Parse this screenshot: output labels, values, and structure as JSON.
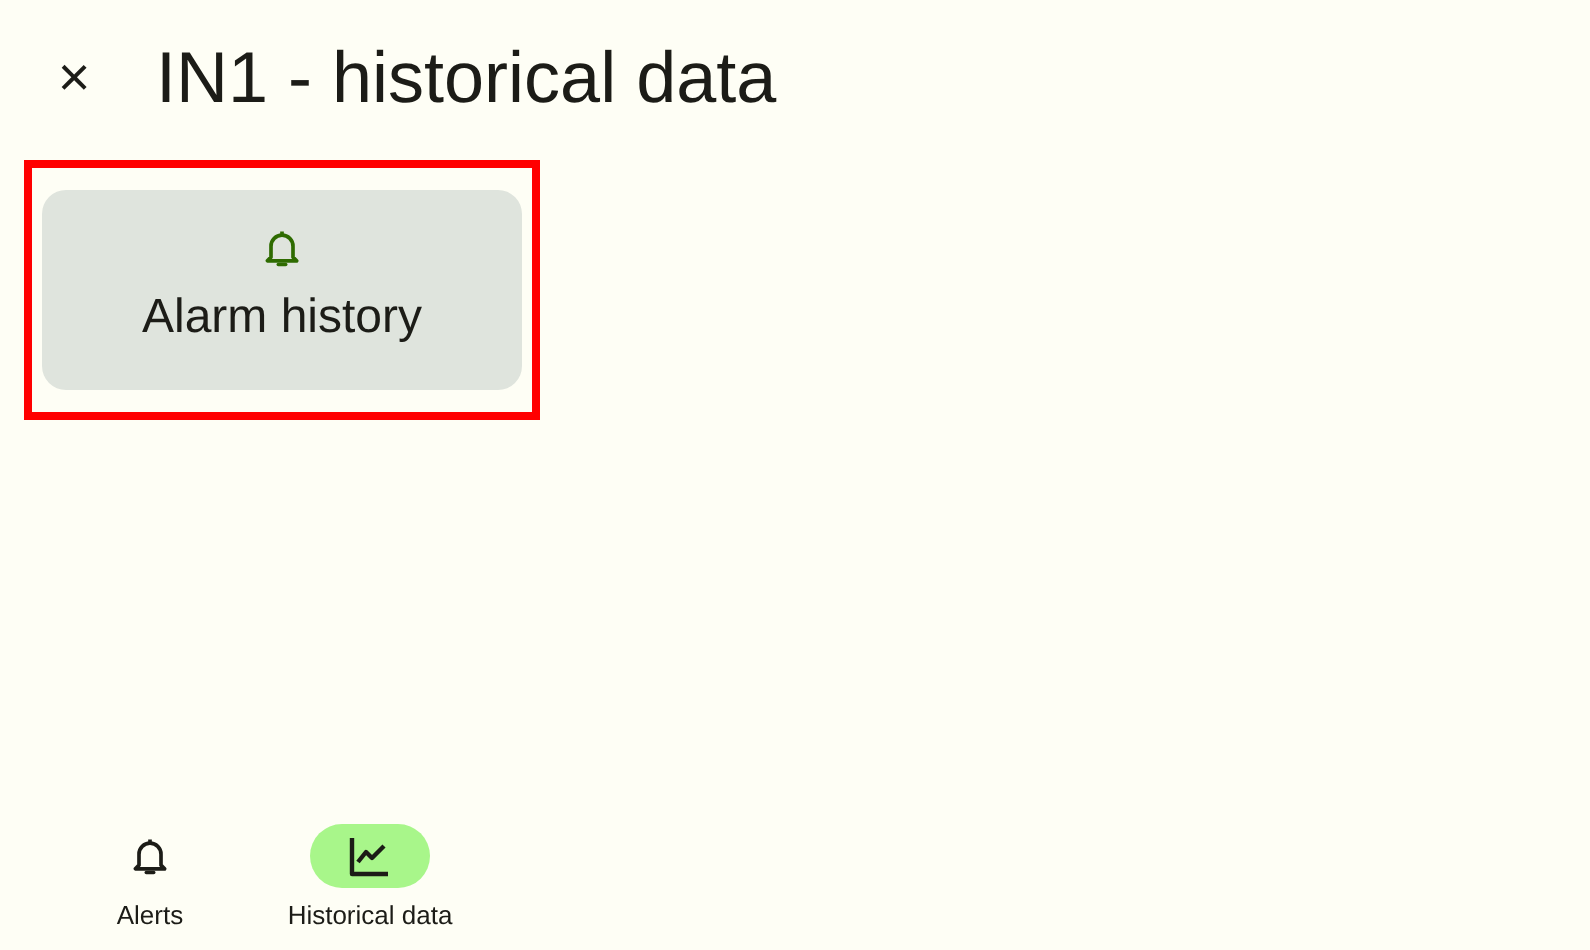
{
  "header": {
    "close": "×",
    "title": "IN1 - historical data"
  },
  "cards": [
    {
      "kind": "bell",
      "label": "Alarm history",
      "highlighted": true
    }
  ],
  "bottom_nav": [
    {
      "kind": "bell",
      "label": "Alerts",
      "selected": false
    },
    {
      "kind": "chart",
      "label": "Historical data",
      "selected": true
    }
  ]
}
